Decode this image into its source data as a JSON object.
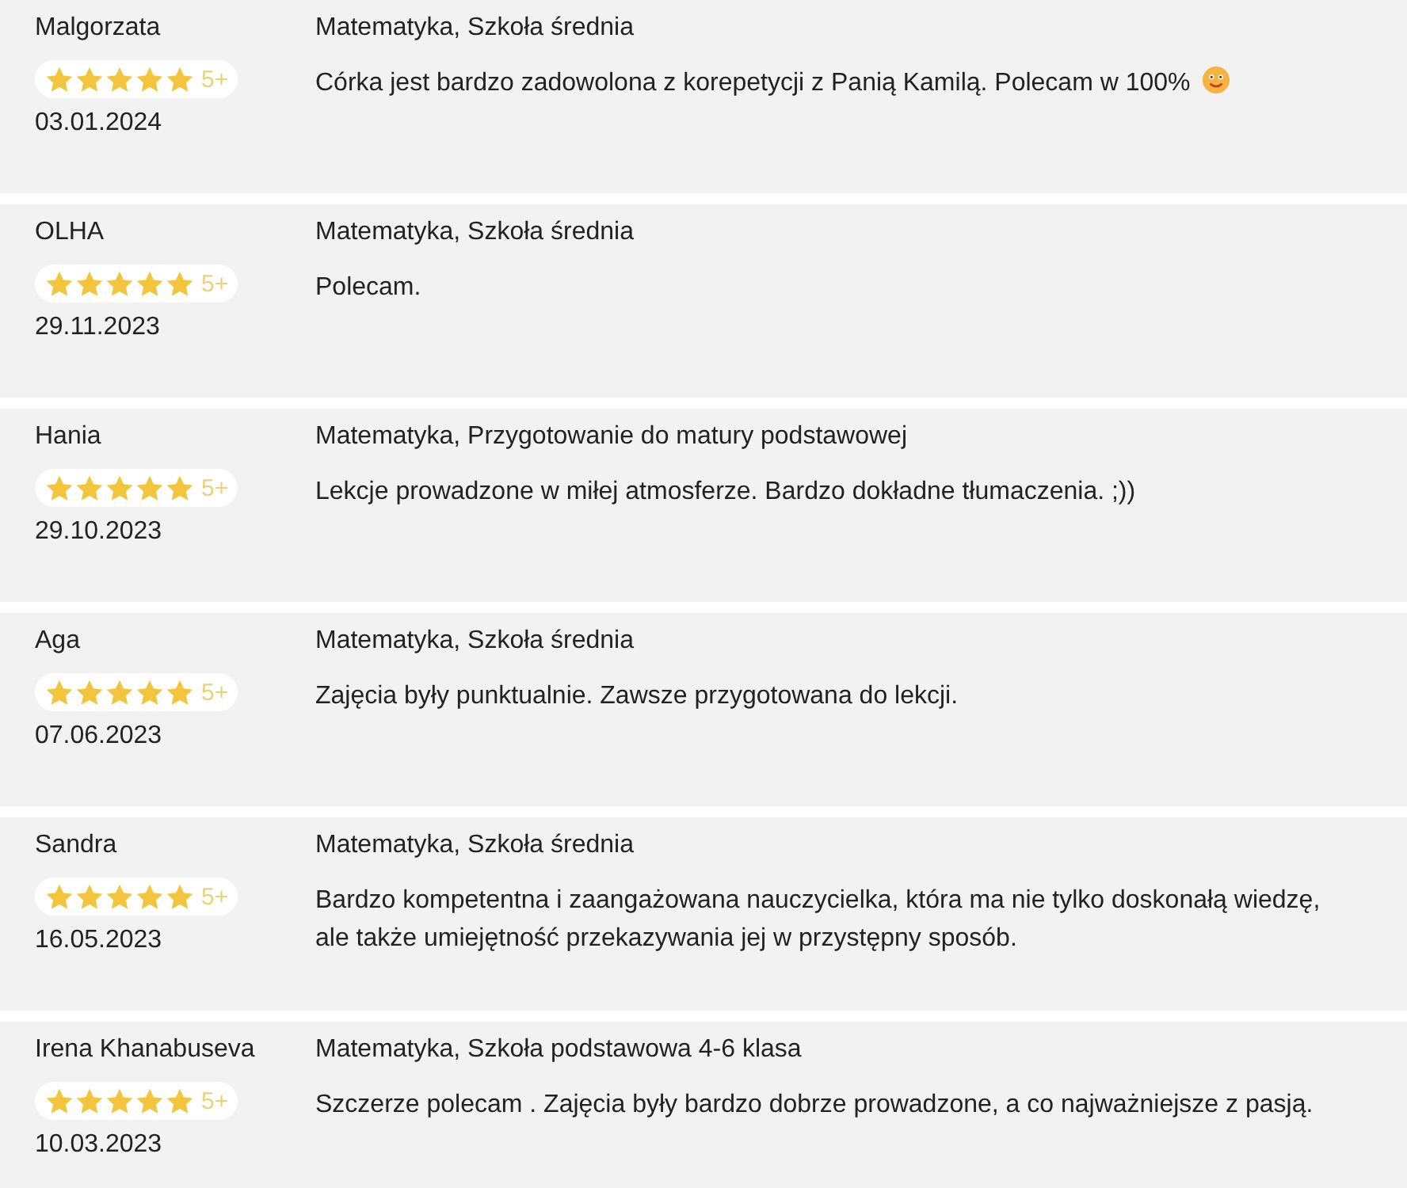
{
  "reviews": [
    {
      "name": "Malgorzata",
      "stars": 5,
      "grade": "5+",
      "date": "03.01.2024",
      "subject": "Matematyka, Szkoła średnia",
      "text": "Córka jest bardzo zadowolona z korepetycji z Panią Kamilą. Polecam w 100%",
      "emoji": true
    },
    {
      "name": "OLHA",
      "stars": 5,
      "grade": "5+",
      "date": "29.11.2023",
      "subject": "Matematyka, Szkoła średnia",
      "text": "Polecam.",
      "emoji": false
    },
    {
      "name": "Hania",
      "stars": 5,
      "grade": "5+",
      "date": "29.10.2023",
      "subject": "Matematyka, Przygotowanie do matury podstawowej",
      "text": "Lekcje prowadzone w miłej atmosferze. Bardzo dokładne tłumaczenia. ;))",
      "emoji": false
    },
    {
      "name": "Aga",
      "stars": 5,
      "grade": "5+",
      "date": "07.06.2023",
      "subject": "Matematyka, Szkoła średnia",
      "text": "Zajęcia były punktualnie. Zawsze przygotowana do lekcji.",
      "emoji": false
    },
    {
      "name": "Sandra",
      "stars": 5,
      "grade": "5+",
      "date": "16.05.2023",
      "subject": "Matematyka, Szkoła średnia",
      "text": "Bardzo kompetentna i zaangażowana nauczycielka, która ma nie tylko doskonałą wiedzę, ale także umiejętność przekazywania jej w przystępny sposób.",
      "emoji": false
    },
    {
      "name": "Irena Khanabuseva",
      "stars": 5,
      "grade": "5+",
      "date": "10.03.2023",
      "subject": "Matematyka, Szkoła podstawowa 4-6 klasa",
      "text": "Szczerze polecam . Zajęcia były bardzo dobrze prowadzone, a co najważniejsze z pasją.",
      "emoji": false
    }
  ]
}
